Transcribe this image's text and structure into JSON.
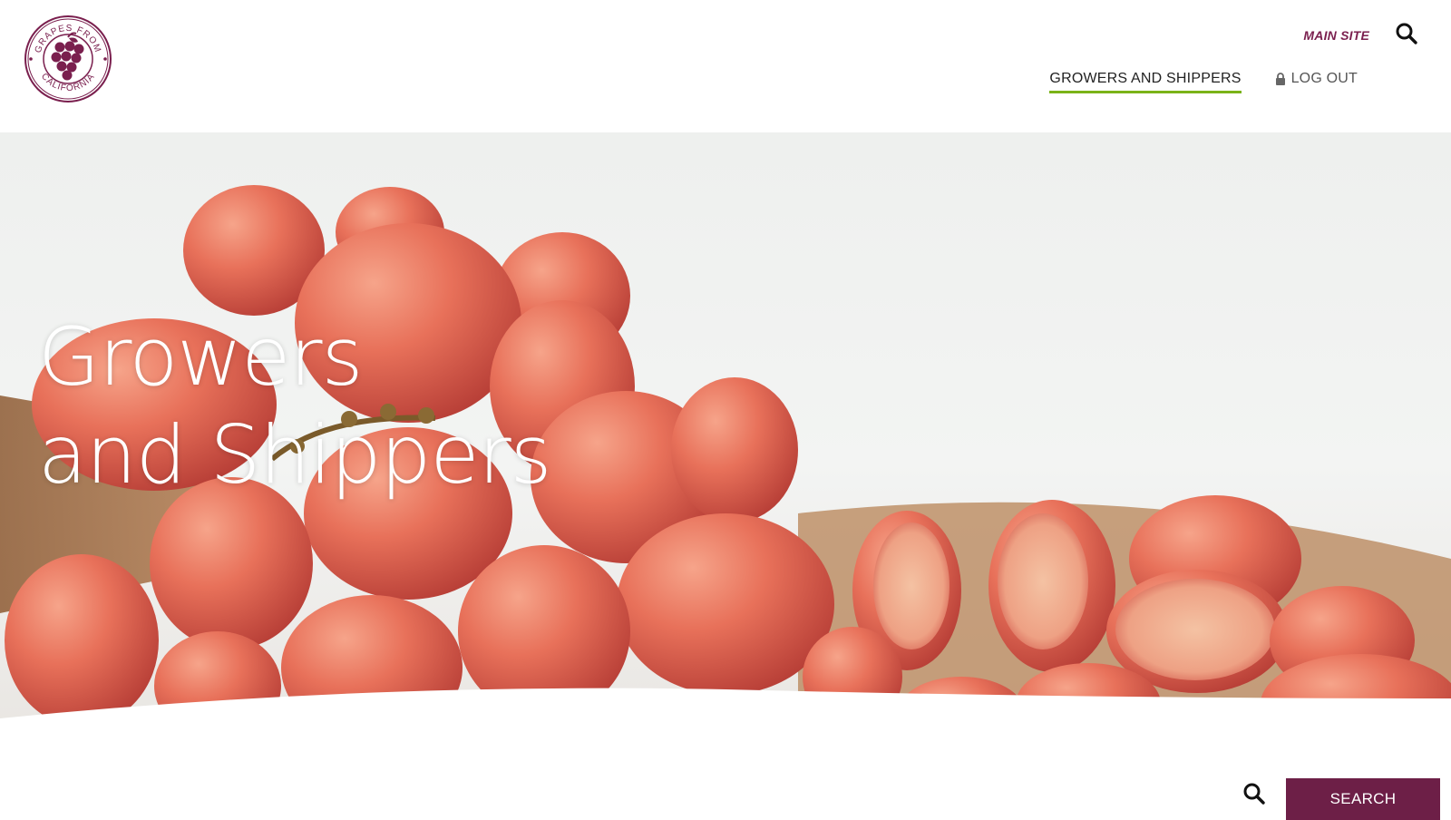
{
  "brand": {
    "logo_text_top": "GRAPES FROM",
    "logo_text_bottom": "CALIFORNIA",
    "logo_icon": "grape-cluster-icon",
    "color_primary": "#6d1f47",
    "color_accent": "#7ab317"
  },
  "header": {
    "main_site_label": "MAIN SITE",
    "search_icon": "search-icon",
    "nav": [
      {
        "label": "GROWERS AND SHIPPERS",
        "active": true
      },
      {
        "label": "LOG OUT",
        "icon": "lock-icon"
      }
    ]
  },
  "hero": {
    "title_line1": "Growers",
    "title_line2": "and Shippers",
    "image": "red-grapes-photo"
  },
  "search": {
    "icon": "search-icon",
    "button_label": "SEARCH"
  }
}
